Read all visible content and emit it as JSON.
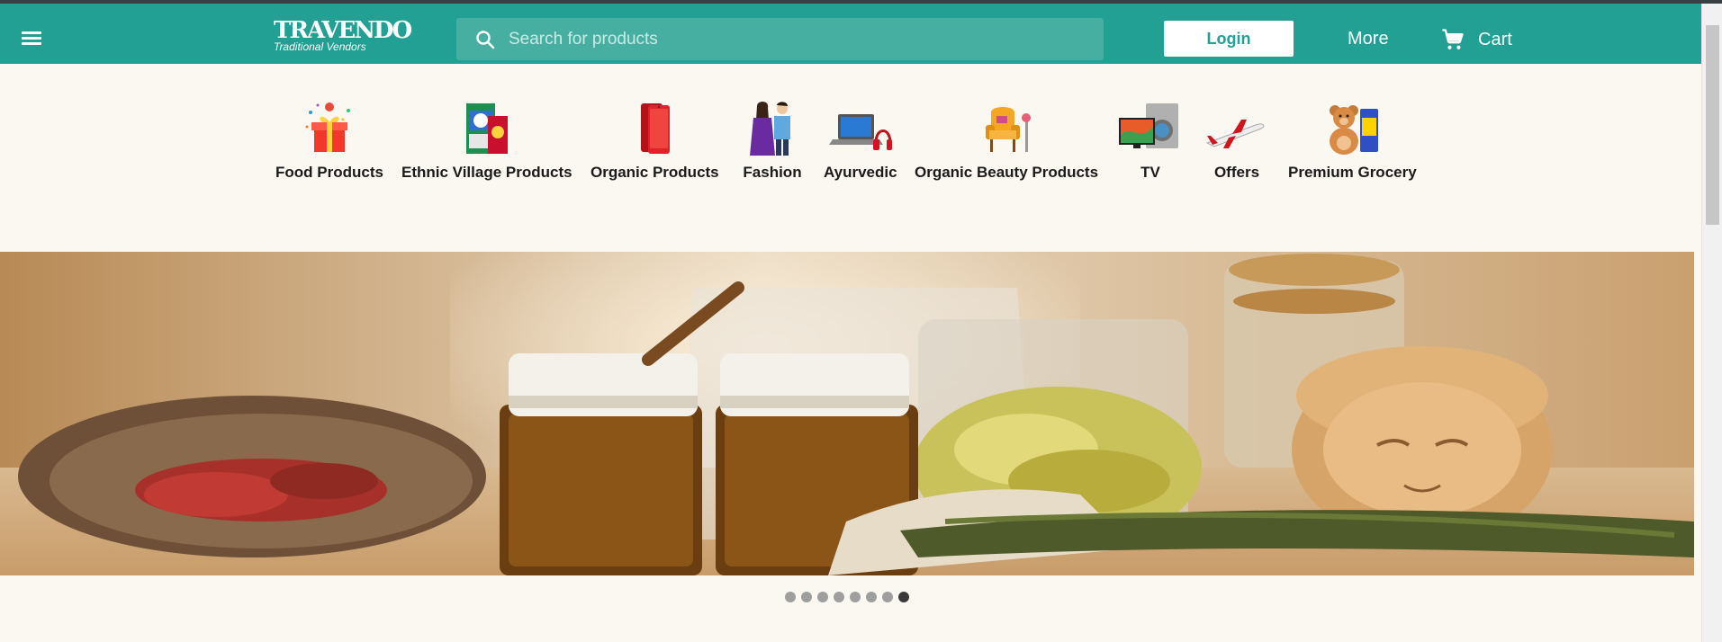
{
  "header": {
    "logo_main": "TRAVENDO",
    "logo_sub": "Traditional Vendors",
    "search_placeholder": "Search for products",
    "login_label": "Login",
    "more_label": "More",
    "cart_label": "Cart"
  },
  "categories": [
    {
      "label": "Food Products",
      "icon": "gift-box-icon"
    },
    {
      "label": "Ethnic Village Products",
      "icon": "detergent-box-icon"
    },
    {
      "label": "Organic Products",
      "icon": "smartphone-icon"
    },
    {
      "label": "Fashion",
      "icon": "couple-fashion-icon"
    },
    {
      "label": "Ayurvedic",
      "icon": "laptop-headphones-icon"
    },
    {
      "label": "Organic Beauty Products",
      "icon": "armchair-icon"
    },
    {
      "label": "TV",
      "icon": "tv-washing-machine-icon"
    },
    {
      "label": "Offers",
      "icon": "airplane-icon"
    },
    {
      "label": "Premium Grocery",
      "icon": "teddy-bear-icon"
    }
  ],
  "carousel": {
    "slide_count": 8,
    "active_index": 7
  },
  "colors": {
    "brand": "#21a093",
    "background": "#fbf7f1"
  }
}
